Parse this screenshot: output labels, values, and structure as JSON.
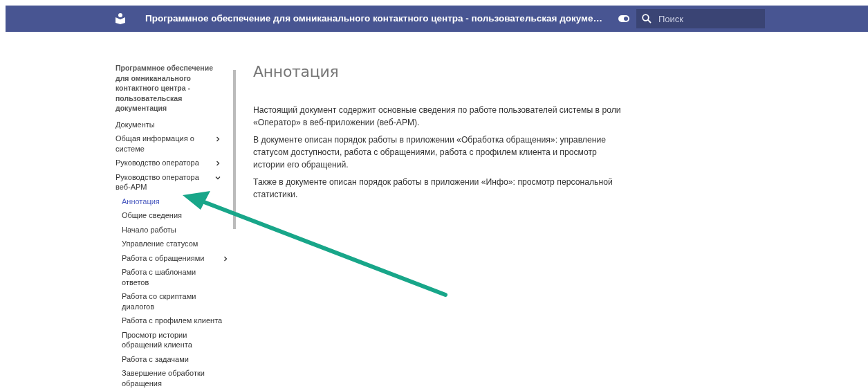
{
  "header": {
    "title": "Программное обеспечение для омниканального контактного центра - пользовательская докуме…",
    "search": {
      "placeholder": "Поиск"
    }
  },
  "sidebar": {
    "title": "Программное обеспечение для омниканального контактного центра - пользовательская документация",
    "items": [
      {
        "label": "Документы",
        "selected": false
      },
      {
        "label": "Общая информация о системе",
        "selected": false,
        "expanded": false
      },
      {
        "label": "Руководство оператора",
        "selected": false,
        "expanded": false
      },
      {
        "label": "Руководство оператора веб-АРМ",
        "selected": false,
        "expanded": true,
        "children": [
          {
            "label": "Аннотация",
            "selected": true
          },
          {
            "label": "Общие сведения",
            "selected": false
          },
          {
            "label": "Начало работы",
            "selected": false
          },
          {
            "label": "Управление статусом",
            "selected": false
          },
          {
            "label": "Работа с обращениями",
            "selected": false,
            "expanded": false
          },
          {
            "label": "Работа с шаблонами ответов",
            "selected": false
          },
          {
            "label": "Работа со скриптами диалогов",
            "selected": false
          },
          {
            "label": "Работа с профилем клиента",
            "selected": false
          },
          {
            "label": "Просмотр истории обращений клиента",
            "selected": false
          },
          {
            "label": "Работа с задачами",
            "selected": false
          },
          {
            "label": "Завершение обработки обращения",
            "selected": false
          }
        ]
      }
    ]
  },
  "article": {
    "title": "Аннотация",
    "paragraphs": [
      "Настоящий документ содержит основные сведения по работе пользователей системы в роли «Оператор» в веб-приложении (веб-АРМ).",
      "В документе описан порядок работы в приложении «Обработка обращения»: управление статусом доступности, работа с обращениями, работа с профилем клиента и просмотр истории его обращений.",
      "Также в документе описан порядок работы в приложении «Инфо»: просмотр персональной статистики."
    ]
  }
}
